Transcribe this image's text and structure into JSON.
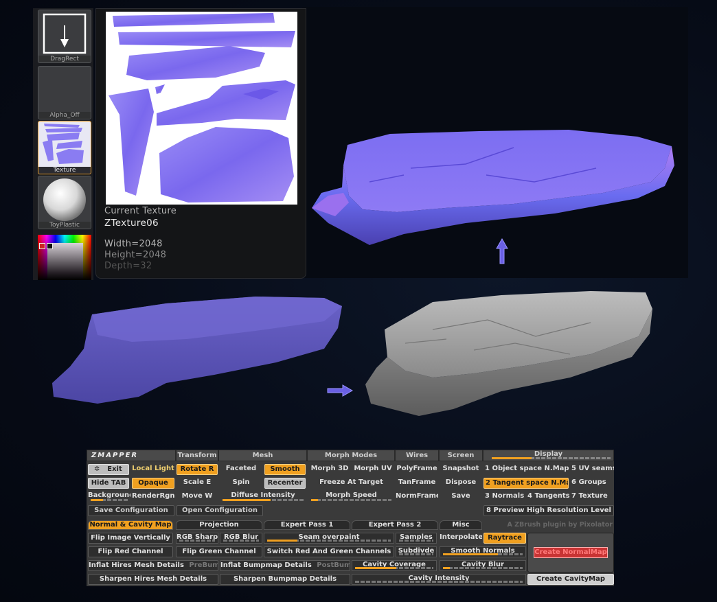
{
  "tools": {
    "dragrect": {
      "label": "DragRect"
    },
    "alpha": {
      "label": "Alpha_Off"
    },
    "texture": {
      "label": "Texture"
    },
    "material": {
      "label": "ToyPlastic"
    }
  },
  "texture_info": {
    "heading": "Current Texture",
    "name": "ZTexture06",
    "width": "Width=2048",
    "height": "Height=2048",
    "depth": "Depth=32"
  },
  "zmapper": {
    "logo": "ZMAPPER",
    "headers": {
      "transform": "Transform",
      "mesh": "Mesh",
      "morph_modes": "Morph Modes",
      "wires": "Wires",
      "screen": "Screen",
      "display": "Display"
    },
    "row1": {
      "exit": "Exit",
      "local_light": "Local Light",
      "rotate": "Rotate  R",
      "faceted": "Faceted",
      "smooth": "Smooth",
      "morph_3d": "Morph 3D",
      "morph_uv": "Morph UV",
      "polyframe": "PolyFrame",
      "snapshot": "Snapshot",
      "object_space": "1 Object space N.Map",
      "uv_seams": "5 UV seams"
    },
    "row2": {
      "hide_tab": "Hide TAB",
      "opaque": "Opaque",
      "scale": "Scale    E",
      "spin": "Spin",
      "recenter": "Recenter",
      "freeze": "Freeze At Target",
      "tanframe": "TanFrame",
      "dispose": "Dispose",
      "tangent_space": "2 Tangent space N.Map",
      "groups": "6 Groups"
    },
    "row3": {
      "background": "Background",
      "render_rgn": "RenderRgn",
      "move": "Move     W",
      "diffuse": "Diffuse Intensity",
      "morph_speed": "Morph Speed",
      "normframe": "NormFrame",
      "save": "Save",
      "normals": "3 Normals",
      "tangents": "4 Tangents",
      "texture": "7 Texture"
    },
    "config": {
      "save": "Save Configuration",
      "open": "Open Configuration",
      "preview": "8 Preview High Resolution Level"
    },
    "tabs": [
      "Normal & Cavity Map",
      "Projection",
      "Expert Pass 1",
      "Expert Pass 2",
      "Misc"
    ],
    "credit": "A ZBrush plugin by Pixolator",
    "options": {
      "flip_vert": "Flip Image Vertically",
      "rgb_sharp": "RGB Sharp",
      "rgb_blur": "RGB Blur",
      "seam_overpaint": "Seam overpaint",
      "samples": "Samples",
      "interpolate": "Interpolate",
      "raytrace": "Raytrace",
      "flip_red": "Flip Red Channel",
      "flip_green": "Flip Green Channel",
      "switch_rg": "Switch Red And Green Channels",
      "subdivide": "Subdivde",
      "smooth_normals": "Smooth Normals",
      "create_normalmap": "Create NormalMap",
      "inflat_hires": "Inflat Hires Mesh Details",
      "prebump": "PreBump",
      "inflat_bump": "Inflat Bumpmap Details",
      "postbump": "PostBump",
      "cavity_coverage": "Cavity Coverage",
      "cavity_blur": "Cavity Blur",
      "sharpen_hires": "Sharpen Hires Mesh Details",
      "sharpen_bump": "Sharpen Bumpmap Details",
      "cavity_intensity": "Cavity Intensity",
      "create_cavitymap": "Create CavityMap"
    }
  },
  "colors": {
    "accent": "#f0a020",
    "normal_map_blue": "#7a6cf0",
    "low_poly_blue": "#5c55b8",
    "hires_grey": "#a9a9a9"
  }
}
